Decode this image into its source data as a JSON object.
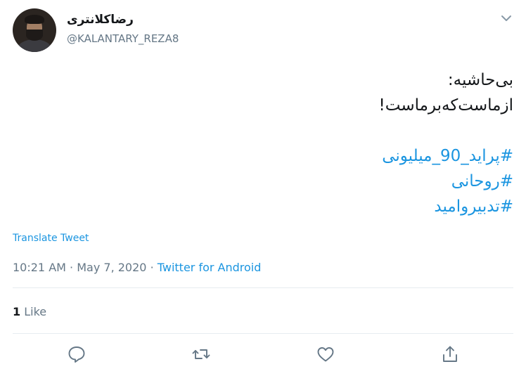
{
  "user": {
    "display_name": "رضاکلانتری",
    "handle": "@KALANTARY_REZA8"
  },
  "tweet": {
    "lines": [
      "بی‌حاشیه:",
      "ازماست‌که‌برماست!"
    ],
    "hashtags": [
      "#پراید_90_میلیونی",
      "#روحانی",
      "#تدبیروامید"
    ]
  },
  "translate_label": "Translate Tweet",
  "meta": {
    "time": "10:21 AM",
    "separator": "·",
    "date": "May 7, 2020",
    "source": "Twitter for Android"
  },
  "stats": {
    "likes_count": "1",
    "likes_label": "Like"
  },
  "icons": {
    "caret": "chevron-down-icon",
    "reply": "reply-icon",
    "retweet": "retweet-icon",
    "like": "heart-icon",
    "share": "share-icon"
  },
  "colors": {
    "accent": "#1b95e0",
    "secondary_text": "#657786",
    "primary_text": "#14171a",
    "divider": "#e6ecf0"
  }
}
